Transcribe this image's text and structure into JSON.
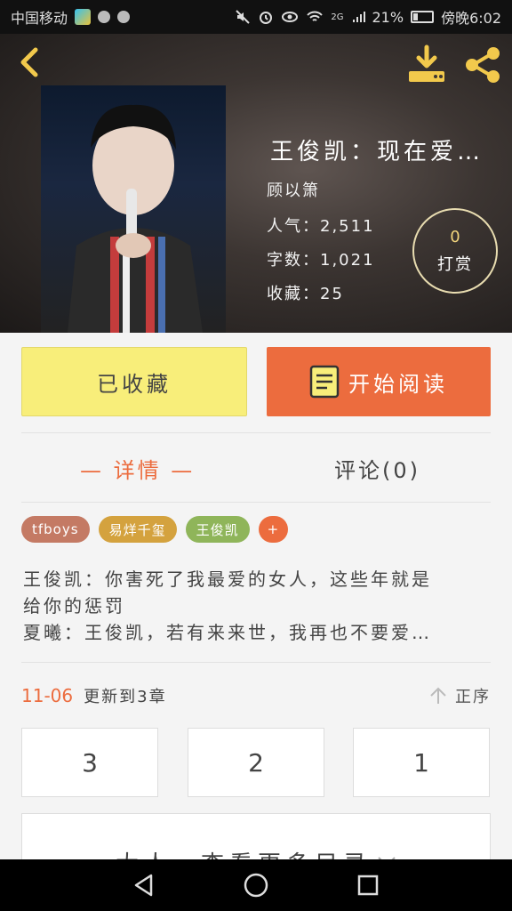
{
  "status_bar": {
    "carrier": "中国移动",
    "network": "2G",
    "battery": "21%",
    "time": "傍晚6:02"
  },
  "header": {
    "back_icon": "chevron-left-icon",
    "download_icon": "download-icon",
    "share_icon": "share-icon",
    "accent_color": "#f2c94c"
  },
  "book": {
    "title": "王俊凯：现在爱…",
    "author": "顾以箫",
    "popularity": "人气：2,511",
    "word_count": "字数：1,021",
    "favorites": "收藏：25"
  },
  "tip": {
    "count": "0",
    "label": "打赏"
  },
  "actions": {
    "favorited_label": "已收藏",
    "read_label": "开始阅读",
    "read_color": "#ec6c3e",
    "favorited_color": "#f8ee7a"
  },
  "tabs": {
    "detail": "— 详情 —",
    "comments": "评论(0)"
  },
  "tags": [
    {
      "label": "tfboys",
      "color": "#c47a64"
    },
    {
      "label": "易烊千玺",
      "color": "#d4a23e"
    },
    {
      "label": "王俊凯",
      "color": "#8fb55a"
    },
    {
      "label": "+",
      "color": "#ec6c3e"
    }
  ],
  "intro": {
    "line1": "王俊凯：你害死了我最爱的女人，这些年就是",
    "line2": "给你的惩罚",
    "line3": "夏曦：王俊凯，若有来来世，我再也不要爱…"
  },
  "update": {
    "date": "11-06",
    "text": "更新到3章",
    "sort_label": "正序"
  },
  "chapters": [
    "3",
    "2",
    "1"
  ],
  "more_label": "大人，查看更多目录"
}
